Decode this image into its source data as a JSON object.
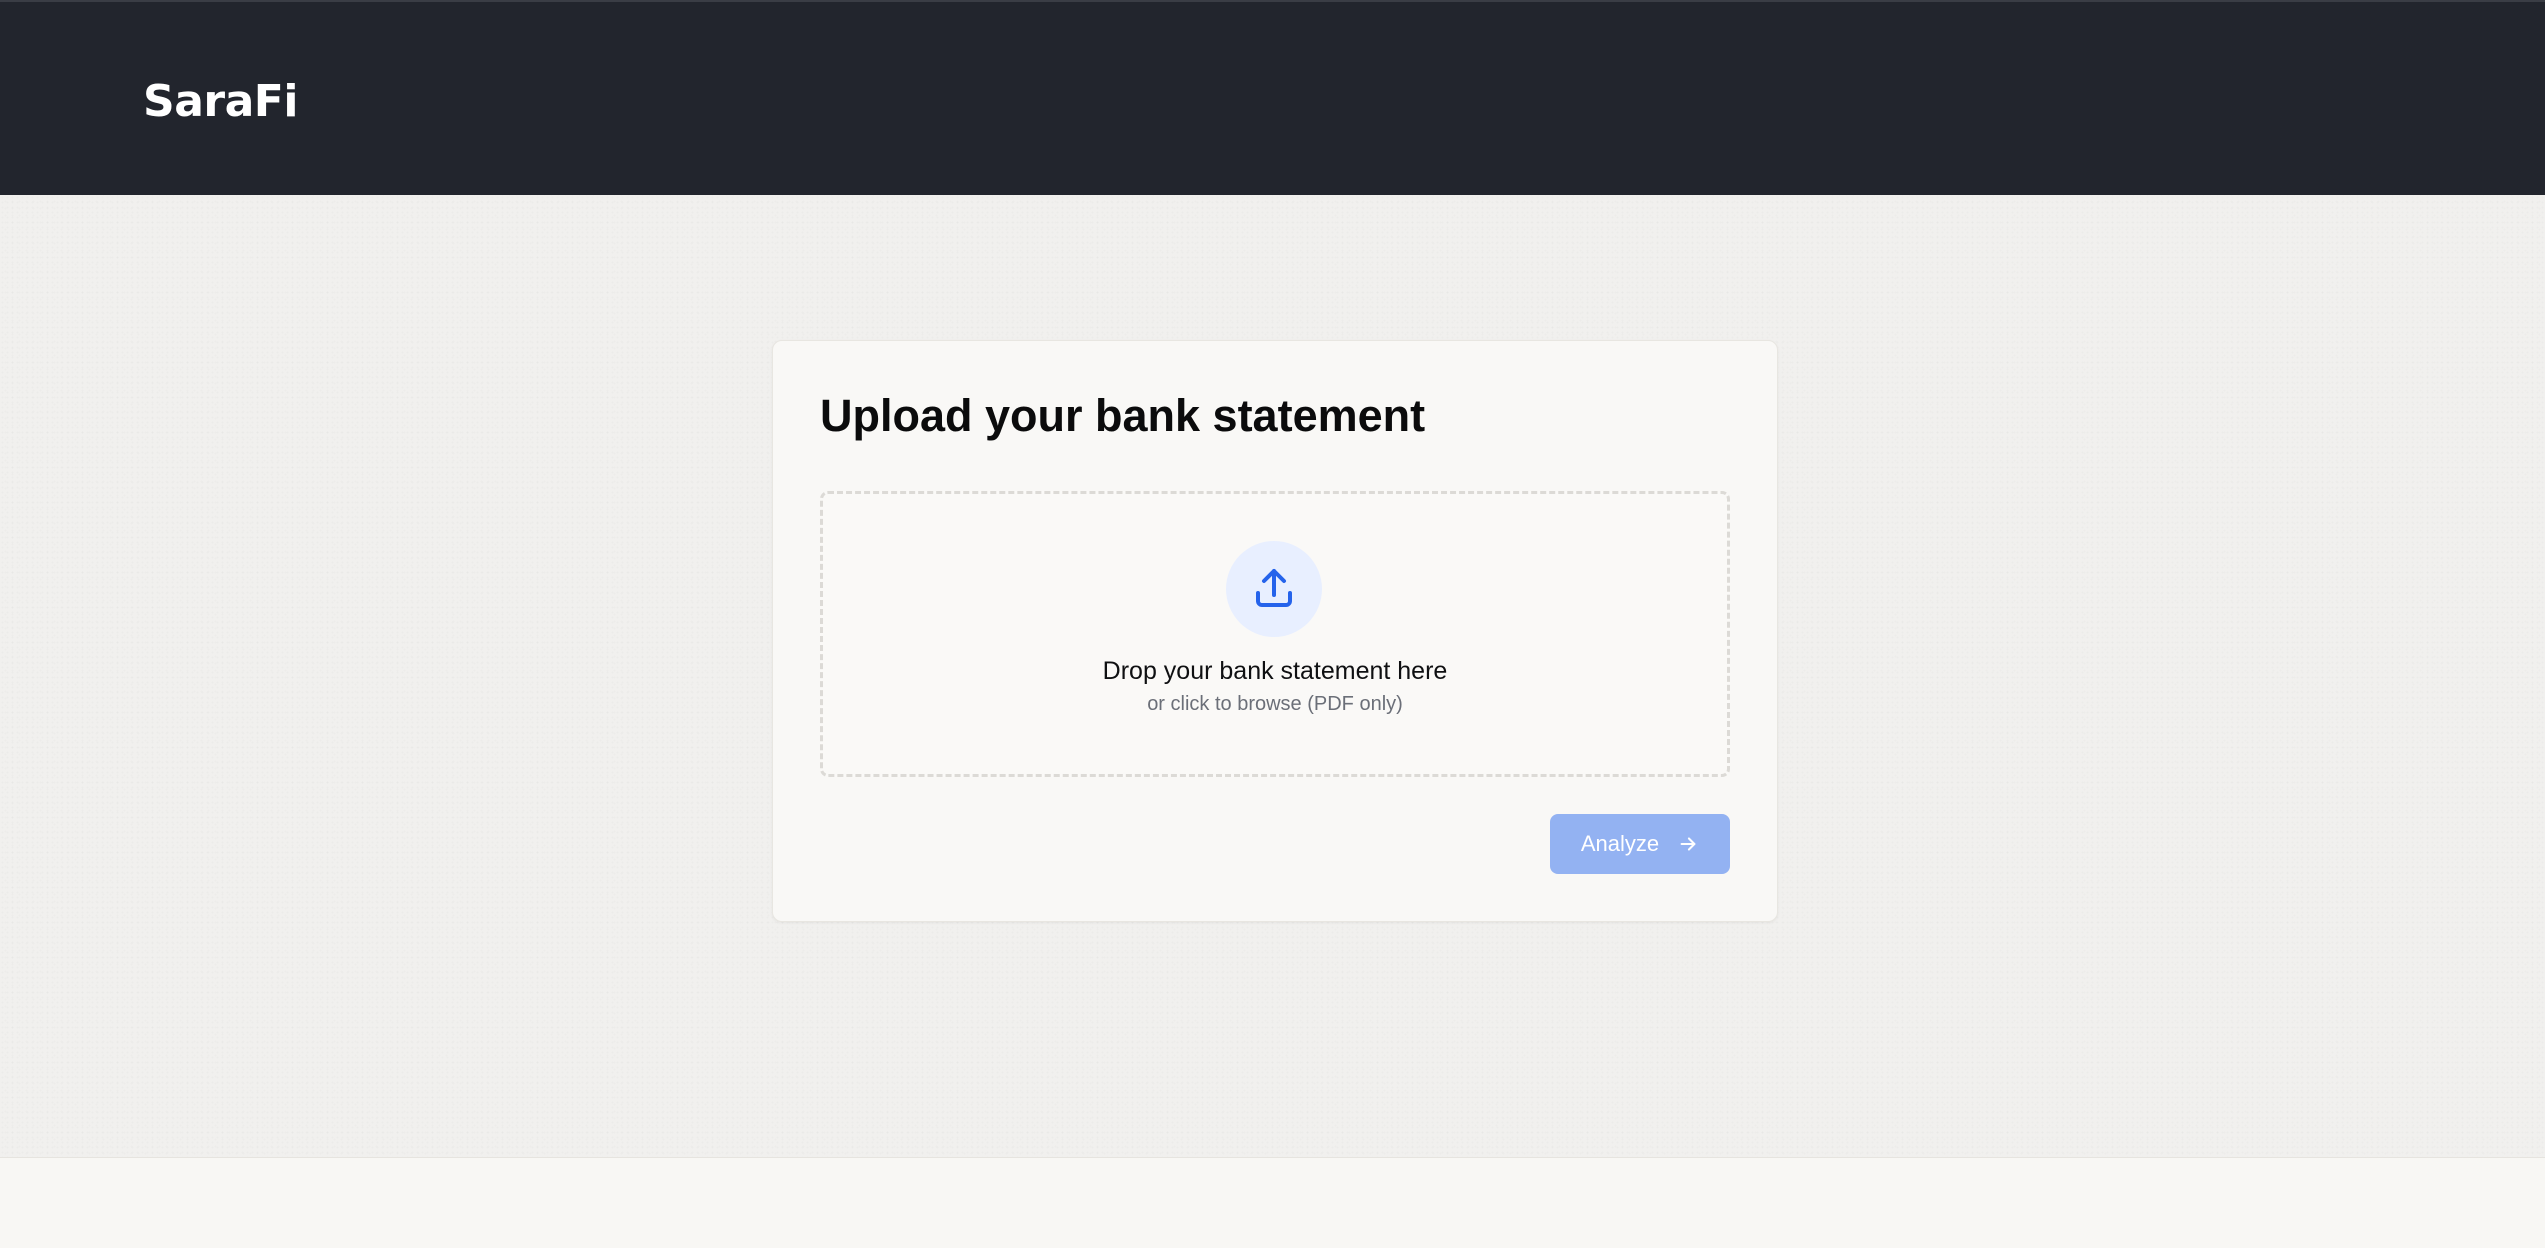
{
  "header": {
    "brand": "SaraFi",
    "background_color": "#22252d"
  },
  "upload_card": {
    "title": "Upload your bank statement",
    "dropzone": {
      "icon": "upload-icon",
      "primary_text": "Drop your bank statement here",
      "secondary_text": "or click to browse (PDF only)",
      "accent_color": "#2563eb"
    },
    "analyze_button": {
      "label": "Analyze",
      "icon": "arrow-right-icon",
      "state": "disabled",
      "color": "#93b2f2"
    }
  }
}
